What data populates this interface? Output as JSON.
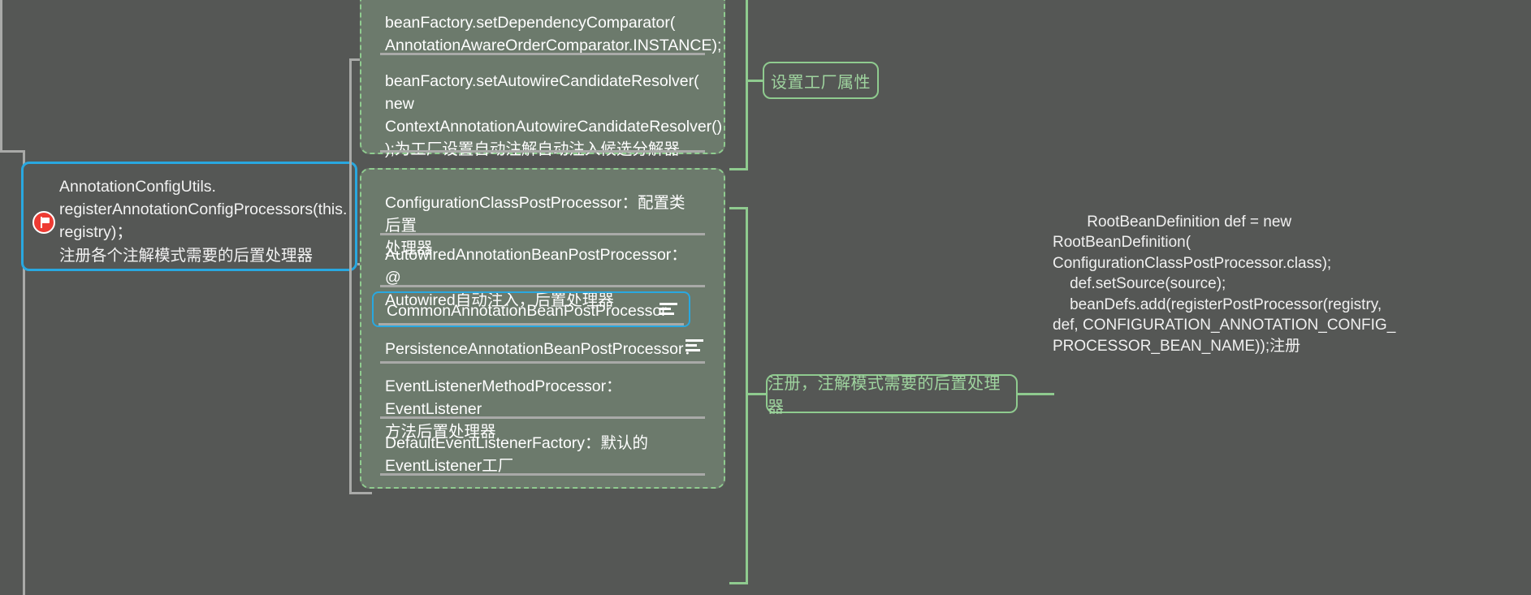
{
  "canvas": {
    "background": "#555755",
    "accent_selected": "#29a8e0",
    "accent_group": "#8fcb8f",
    "group_fill": "#6c7a6c",
    "connector": "#a9aaa8"
  },
  "focused_topic": {
    "line1": "AnnotationConfigUtils.\nregisterAnnotationConfigProcessors(this.\nregistry)；",
    "line2": "注册各个注解模式需要的后置处理器",
    "flag_icon": "red-flag-marker-icon",
    "border_color": "#29a8e0"
  },
  "collapse_button": {
    "icon": "minus-circle-icon",
    "state": "expanded"
  },
  "group_factory": {
    "label": "设置工厂属性",
    "items": [
      {
        "text": "beanFactory.setDependencyComparator(\nAnnotationAwareOrderComparator.INSTANCE);",
        "has_note": false
      },
      {
        "text": "beanFactory.setAutowireCandidateResolver(\nnew\nContextAnnotationAutowireCandidateResolver()\n);为工厂设置自动注解自动注入候选分解器",
        "has_note": false
      }
    ]
  },
  "group_processors": {
    "label": "注册，注解模式需要的后置处理器",
    "items": [
      {
        "text": "ConfigurationClassPostProcessor：配置类后置\n处理器",
        "has_note": false,
        "selected": false
      },
      {
        "text": "AutowiredAnnotationBeanPostProcessor：@\nAutowired自动注入，后置处理器",
        "has_note": false,
        "selected": false
      },
      {
        "text": "CommonAnnotationBeanPostProcessor",
        "has_note": true,
        "note_icon": "note-lines-icon",
        "selected": true
      },
      {
        "text": "PersistenceAnnotationBeanPostProcessor：",
        "has_note": true,
        "note_icon": "note-lines-icon",
        "selected": false
      },
      {
        "text": "EventListenerMethodProcessor：EventListener\n方法后置处理器",
        "has_note": false,
        "selected": false
      },
      {
        "text": "DefaultEventListenerFactory：默认的\nEventListener工厂",
        "has_note": false,
        "selected": false
      }
    ]
  },
  "right_note": {
    "text": "    RootBeanDefinition def = new\nRootBeanDefinition(\nConfigurationClassPostProcessor.class);\n    def.setSource(source);\n    beanDefs.add(registerPostProcessor(registry,\ndef, CONFIGURATION_ANNOTATION_CONFIG_\nPROCESSOR_BEAN_NAME));注册"
  }
}
